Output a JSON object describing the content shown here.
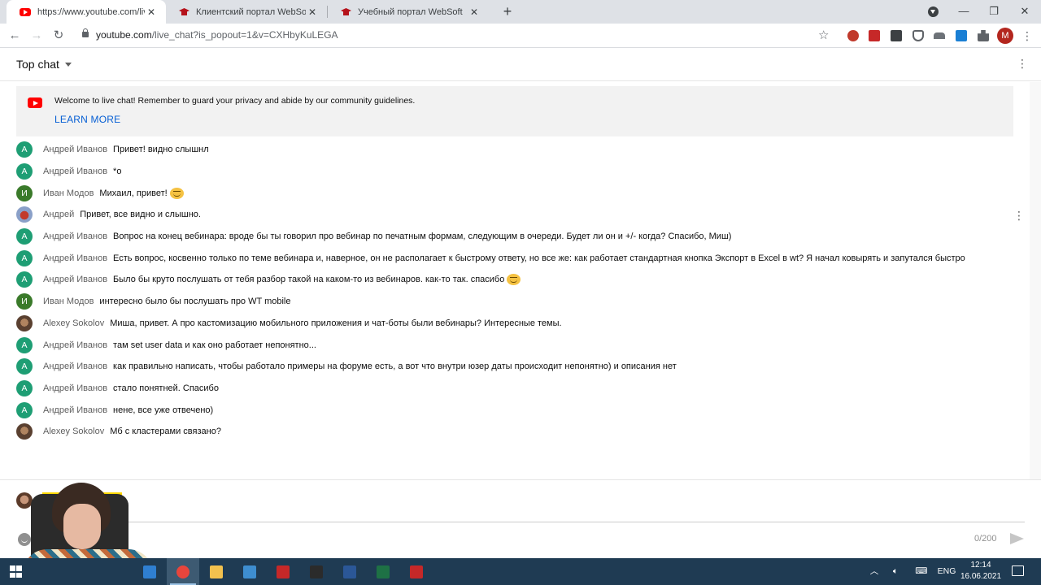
{
  "browser": {
    "tabs": [
      {
        "title": "https://www.youtube.com/live_c",
        "favicon": "youtube-icon",
        "active": true
      },
      {
        "title": "Клиентский портал WebSoft",
        "favicon": "websoft-icon",
        "active": false
      },
      {
        "title": "Учебный портал WebSoft",
        "favicon": "websoft-icon",
        "active": false
      }
    ],
    "url_host": "youtube.com",
    "url_rest": "/live_chat?is_popout=1&v=CXHbyKuLEGA",
    "profile_initial": "M"
  },
  "chat": {
    "header_title": "Top chat",
    "welcome_text": "Welcome to live chat! Remember to guard your privacy and abide by our community guidelines.",
    "learn_more": "LEARN MORE",
    "messages": [
      {
        "author": "Андрей Иванов",
        "text": "Привет! видно слышнл",
        "avatar": "А",
        "avatar_color": "teal",
        "emoji": false
      },
      {
        "author": "Андрей Иванов",
        "text": "*о",
        "avatar": "А",
        "avatar_color": "teal",
        "emoji": false
      },
      {
        "author": "Иван Модов",
        "text": "Михаил, привет!",
        "avatar": "И",
        "avatar_color": "green",
        "emoji": true
      },
      {
        "author": "Андрей",
        "text": "Привет, все видно и слышно.",
        "avatar": "",
        "avatar_color": "photo1",
        "emoji": false
      },
      {
        "author": "Андрей Иванов",
        "text": "Вопрос на конец вебинара: вроде бы ты говорил про вебинар по печатным формам, следующим в очереди. Будет ли он и +/- когда? Спасибо, Миш)",
        "avatar": "А",
        "avatar_color": "teal",
        "emoji": false
      },
      {
        "author": "Андрей Иванов",
        "text": "Есть вопрос, косвенно только по теме вебинара и, наверное, он не располагает к быстрому ответу, но все же: как работает стандартная кнопка Экспорт в Excel в wt? Я начал ковырять и запутался быстро",
        "avatar": "А",
        "avatar_color": "teal",
        "emoji": false
      },
      {
        "author": "Андрей Иванов",
        "text": "Было бы круто послушать от тебя разбор такой на каком-то из вебинаров. как-то так. спасибо",
        "avatar": "А",
        "avatar_color": "teal",
        "emoji": true
      },
      {
        "author": "Иван Модов",
        "text": "интересно было бы послушать про WT mobile",
        "avatar": "И",
        "avatar_color": "green",
        "emoji": false
      },
      {
        "author": "Alexey Sokolov",
        "text": "Миша, привет. А про кастомизацию мобильного приложения и чат-боты были вебинары? Интересные темы.",
        "avatar": "",
        "avatar_color": "photo2",
        "emoji": false
      },
      {
        "author": "Андрей Иванов",
        "text": "там set user data и как оно работает непонятно...",
        "avatar": "А",
        "avatar_color": "teal",
        "emoji": false
      },
      {
        "author": "Андрей Иванов",
        "text": "как правильно написать, чтобы работало примеры на форуме есть, а вот что внутри юзер даты происходит непонятно) и описания нет",
        "avatar": "А",
        "avatar_color": "teal",
        "emoji": false
      },
      {
        "author": "Андрей Иванов",
        "text": "стало понятней. Спасибо",
        "avatar": "А",
        "avatar_color": "teal",
        "emoji": false
      },
      {
        "author": "Андрей Иванов",
        "text": "нене, все уже отвечено)",
        "avatar": "А",
        "avatar_color": "teal",
        "emoji": false
      },
      {
        "author": "Alexey Sokolov",
        "text": "Мб с кластерами связано?",
        "avatar": "",
        "avatar_color": "photo2",
        "emoji": false
      }
    ],
    "input": {
      "placeholder": "",
      "counter": "0/200"
    }
  },
  "taskbar": {
    "lang": "ENG",
    "time": "12:14",
    "date": "16.06.2021",
    "apps": [
      {
        "name": "sourcetree-app",
        "color": "#2f7fd1"
      },
      {
        "name": "chrome-app",
        "color": "#e8453c"
      },
      {
        "name": "explorer-app",
        "color": "#f2c14e"
      },
      {
        "name": "remote-desktop-app",
        "color": "#3e8ed0"
      },
      {
        "name": "checkers-app",
        "color": "#c62828"
      },
      {
        "name": "obs-app",
        "color": "#2b2b2b"
      },
      {
        "name": "word-app",
        "color": "#2b5797"
      },
      {
        "name": "excel-app",
        "color": "#1e7145"
      },
      {
        "name": "acrobat-app",
        "color": "#c62828"
      }
    ]
  },
  "colors": {
    "accent_blue": "#065fd4",
    "avatar_teal": "#1e9e74",
    "avatar_green": "#3a7a2a",
    "badge_yellow": "#ffd600"
  }
}
